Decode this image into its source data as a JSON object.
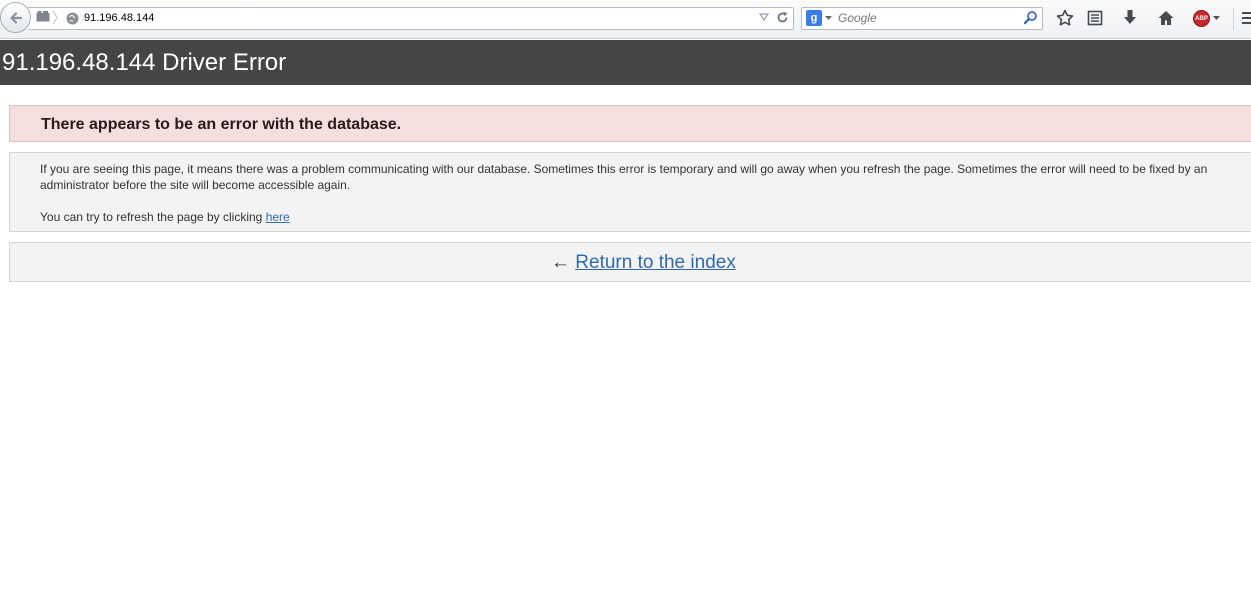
{
  "browser": {
    "url": "91.196.48.144",
    "search_placeholder": "Google",
    "search_engine_letter": "g",
    "adblock_label": "ABP"
  },
  "page": {
    "title": "91.196.48.144 Driver Error",
    "error_heading": "There appears to be an error with the database.",
    "info_text": "If you are seeing this page, it means there was a problem communicating with our database. Sometimes this error is temporary and will go away when you refresh the page. Sometimes the error will need to be fixed by an administrator before the site will become accessible again.",
    "refresh_prefix": "You can try to refresh the page by clicking ",
    "refresh_link": "here",
    "return_arrow": "←",
    "return_link": "Return to the index"
  },
  "colors": {
    "header_bg": "#454545",
    "error_bg": "#f4dede",
    "panel_bg": "#f3f3f3",
    "link": "#2f6ba8"
  }
}
